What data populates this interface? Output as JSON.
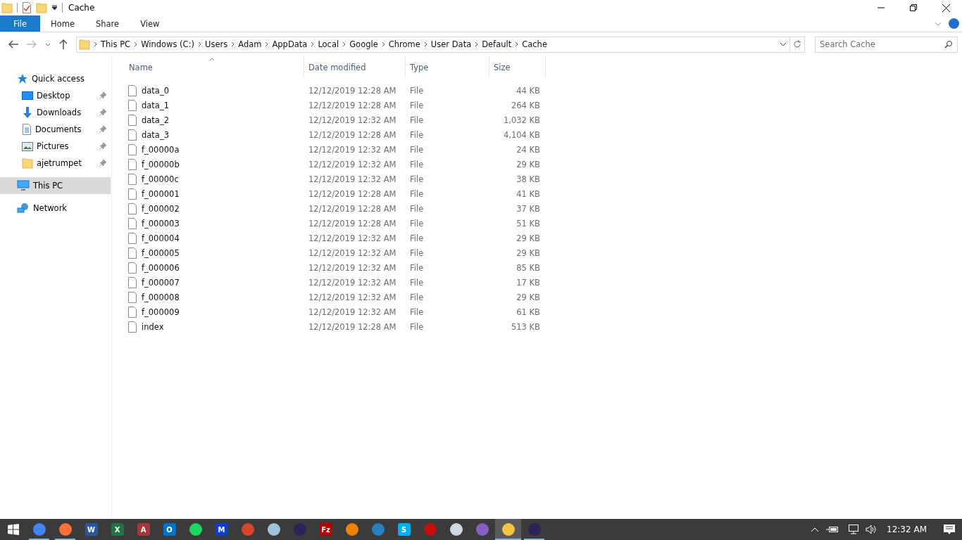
{
  "window": {
    "title": "Cache"
  },
  "ribbon_tabs": [
    {
      "label": "File",
      "selected": true
    },
    {
      "label": "Home",
      "selected": false
    },
    {
      "label": "Share",
      "selected": false
    },
    {
      "label": "View",
      "selected": false
    }
  ],
  "breadcrumb": [
    "This PC",
    "Windows (C:)",
    "Users",
    "Adam",
    "AppData",
    "Local",
    "Google",
    "Chrome",
    "User Data",
    "Default",
    "Cache"
  ],
  "search": {
    "placeholder": "Search Cache"
  },
  "sidebar": {
    "items": [
      {
        "label": "Quick access",
        "kind": "quick",
        "pinned": false,
        "selected": false,
        "indent": false
      },
      {
        "label": "Desktop",
        "kind": "desktop",
        "pinned": true,
        "selected": false,
        "indent": true
      },
      {
        "label": "Downloads",
        "kind": "downloads",
        "pinned": true,
        "selected": false,
        "indent": true
      },
      {
        "label": "Documents",
        "kind": "documents",
        "pinned": true,
        "selected": false,
        "indent": true
      },
      {
        "label": "Pictures",
        "kind": "pictures",
        "pinned": true,
        "selected": false,
        "indent": true
      },
      {
        "label": "ajetrumpet",
        "kind": "folder",
        "pinned": true,
        "selected": false,
        "indent": true
      },
      {
        "label": "This PC",
        "kind": "pc",
        "pinned": false,
        "selected": true,
        "indent": false
      },
      {
        "label": "Network",
        "kind": "network",
        "pinned": false,
        "selected": false,
        "indent": false
      }
    ]
  },
  "table": {
    "columns": [
      "Name",
      "Date modified",
      "Type",
      "Size"
    ],
    "rows": [
      [
        "data_0",
        "12/12/2019 12:28 AM",
        "File",
        "44 KB"
      ],
      [
        "data_1",
        "12/12/2019 12:28 AM",
        "File",
        "264 KB"
      ],
      [
        "data_2",
        "12/12/2019 12:32 AM",
        "File",
        "1,032 KB"
      ],
      [
        "data_3",
        "12/12/2019 12:28 AM",
        "File",
        "4,104 KB"
      ],
      [
        "f_00000a",
        "12/12/2019 12:32 AM",
        "File",
        "24 KB"
      ],
      [
        "f_00000b",
        "12/12/2019 12:32 AM",
        "File",
        "29 KB"
      ],
      [
        "f_00000c",
        "12/12/2019 12:32 AM",
        "File",
        "38 KB"
      ],
      [
        "f_000001",
        "12/12/2019 12:28 AM",
        "File",
        "41 KB"
      ],
      [
        "f_000002",
        "12/12/2019 12:28 AM",
        "File",
        "37 KB"
      ],
      [
        "f_000003",
        "12/12/2019 12:28 AM",
        "File",
        "51 KB"
      ],
      [
        "f_000004",
        "12/12/2019 12:32 AM",
        "File",
        "29 KB"
      ],
      [
        "f_000005",
        "12/12/2019 12:32 AM",
        "File",
        "29 KB"
      ],
      [
        "f_000006",
        "12/12/2019 12:32 AM",
        "File",
        "85 KB"
      ],
      [
        "f_000007",
        "12/12/2019 12:32 AM",
        "File",
        "17 KB"
      ],
      [
        "f_000008",
        "12/12/2019 12:32 AM",
        "File",
        "29 KB"
      ],
      [
        "f_000009",
        "12/12/2019 12:32 AM",
        "File",
        "61 KB"
      ],
      [
        "index",
        "12/12/2019 12:28 AM",
        "File",
        "513 KB"
      ]
    ]
  },
  "taskbar": {
    "apps": [
      {
        "color": "#4285f4",
        "running": true,
        "active": false
      },
      {
        "color": "#ff7139",
        "running": true,
        "active": false
      },
      {
        "color": "#2b579a",
        "glyph": "W",
        "running": false,
        "active": false
      },
      {
        "color": "#217346",
        "glyph": "X",
        "running": false,
        "active": false
      },
      {
        "color": "#a4373a",
        "glyph": "A",
        "running": false,
        "active": false
      },
      {
        "color": "#0072c6",
        "glyph": "O",
        "running": false,
        "active": false
      },
      {
        "color": "#1ed760",
        "running": false,
        "active": false
      },
      {
        "color": "#0d3ecc",
        "glyph": "M",
        "running": false,
        "active": false
      },
      {
        "color": "#d9442c",
        "running": false,
        "active": false
      },
      {
        "color": "#9fc3d9",
        "running": false,
        "active": false
      },
      {
        "color": "#2c2255",
        "running": false,
        "active": false
      },
      {
        "color": "#b20000",
        "glyph": "Fz",
        "running": false,
        "active": false
      },
      {
        "color": "#f08200",
        "running": false,
        "active": false
      },
      {
        "color": "#2a7fbf",
        "running": false,
        "active": false
      },
      {
        "color": "#00aff0",
        "glyph": "S",
        "running": false,
        "active": false
      },
      {
        "color": "#c50f0f",
        "running": false,
        "active": false
      },
      {
        "color": "#cfd8e3",
        "running": false,
        "active": false
      },
      {
        "color": "#865fc5",
        "running": false,
        "active": false
      },
      {
        "color": "#f5c342",
        "running": true,
        "active": true
      },
      {
        "color": "#2c2255",
        "running": true,
        "active": false
      }
    ],
    "clock": "12:32 AM"
  }
}
